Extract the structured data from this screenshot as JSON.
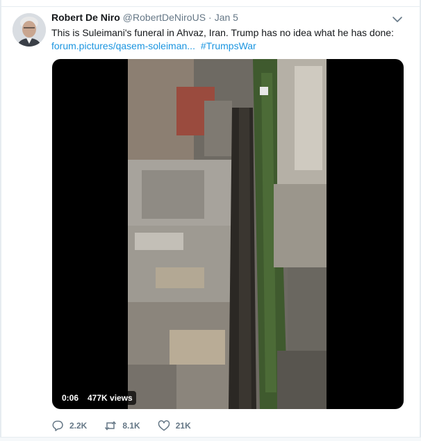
{
  "tweet": {
    "author_name": "Robert De Niro",
    "handle": "@RobertDeNiroUS",
    "separator": "·",
    "timestamp": "Jan 5",
    "text_line1": "This is Suleimani's funeral in Ahvaz, Iran. Trump has no idea what he has done:",
    "link_text": "forum.pictures/qasem-soleiman...",
    "hashtag": "#TrumpsWar",
    "video": {
      "duration": "0:06",
      "views": "477K views"
    },
    "actions": {
      "reply_count": "2.2K",
      "retweet_count": "8.1K",
      "like_count": "21K"
    }
  },
  "icons": {
    "more_menu": "chevron-down-icon",
    "reply": "reply-icon",
    "retweet": "retweet-icon",
    "like": "heart-icon"
  },
  "colors": {
    "link": "#1b95e0",
    "secondary_text": "#657786",
    "primary_text": "#14171a"
  }
}
